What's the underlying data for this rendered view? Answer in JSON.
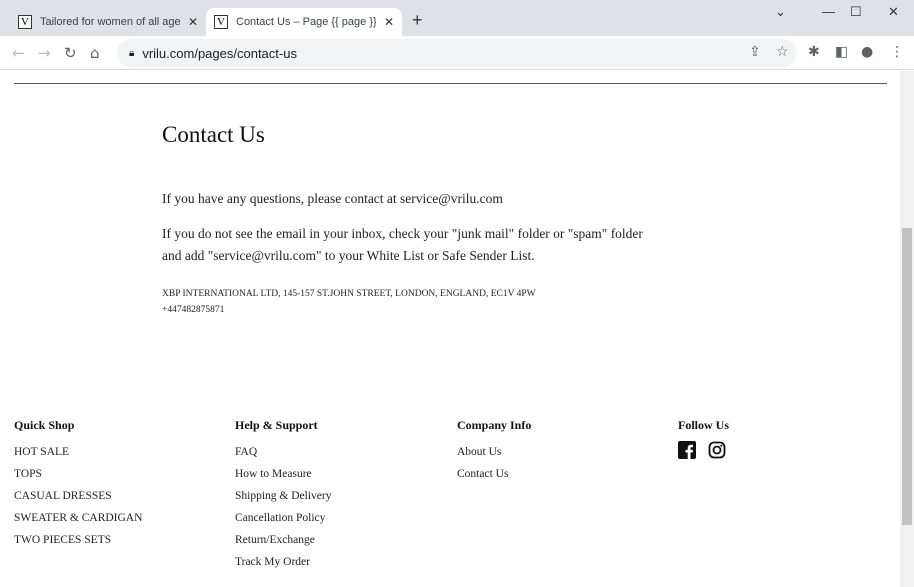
{
  "browser": {
    "tabs": [
      {
        "title": "Tailored for women of all ages – ",
        "favicon": "V"
      },
      {
        "title": "Contact Us – Page {{ page }} – vrilu",
        "favicon": "V"
      }
    ],
    "url": "vrilu.com/pages/contact-us"
  },
  "page": {
    "title": "Contact Us",
    "p1": "If you have any questions, please contact at service@vrilu.com",
    "p2": "If you do not see the email in your inbox, check your \"junk mail\" folder or \"spam\" folder and add \"service@vrilu.com\" to your White List or Safe Sender List.",
    "address": "XBP INTERNATIONAL LTD, 145-157 ST.JOHN STREET, LONDON, ENGLAND, EC1V 4PW",
    "phone": "+447482875871"
  },
  "footer": {
    "quick_shop": {
      "title": "Quick Shop",
      "items": [
        "HOT SALE",
        "TOPS",
        "CASUAL DRESSES",
        "SWEATER & CARDIGAN",
        "TWO PIECES SETS"
      ]
    },
    "help": {
      "title": "Help & Support",
      "items": [
        "FAQ",
        "How to Measure",
        "Shipping & Delivery",
        "Cancellation Policy",
        "Return/Exchange",
        "Track My Order"
      ]
    },
    "company": {
      "title": "Company Info",
      "items": [
        "About Us",
        "Contact Us"
      ]
    },
    "follow": {
      "title": "Follow Us",
      "icons": [
        "facebook-icon",
        "instagram-icon"
      ]
    }
  }
}
